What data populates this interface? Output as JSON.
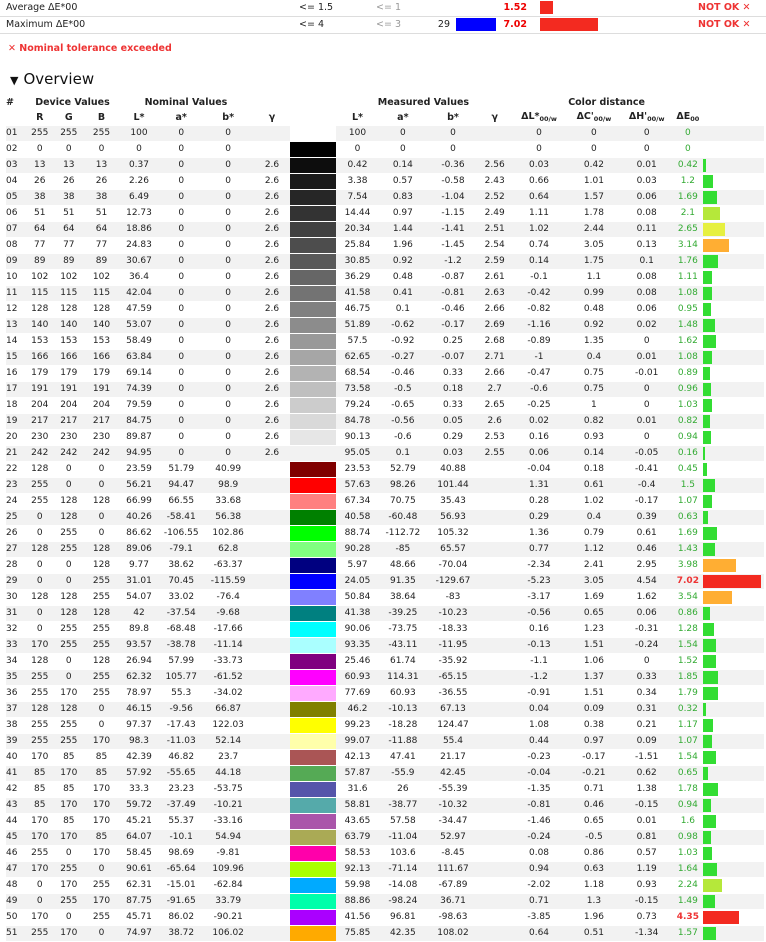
{
  "summary": {
    "rows": [
      {
        "label": "Average ΔE*00",
        "target": "<= 1.5",
        "nominal": "<= 1",
        "count": "",
        "value": "1.52",
        "value_num": 1.52,
        "bar_color": "#f32a20",
        "result": "NOT OK ✕"
      },
      {
        "label": "Maximum ΔE*00",
        "target": "<= 4",
        "nominal": "<= 3",
        "count": "29",
        "value": "7.02",
        "value_num": 7.02,
        "swatch": "#0000ff",
        "bar_color": "#f32a20",
        "result": "NOT OK ✕"
      }
    ],
    "warning": "✕ Nominal tolerance exceeded"
  },
  "overview": {
    "title": "Overview",
    "toggle": "▼",
    "group_headers": {
      "num": "#",
      "device": "Device Values",
      "nominal": "Nominal Values",
      "measured": "Measured Values",
      "distance": "Color distance"
    },
    "col_headers": [
      "R",
      "G",
      "B",
      "L*",
      "a*",
      "b*",
      "γ",
      "L*",
      "a*",
      "b*",
      "γ",
      "ΔL*",
      "ΔC'",
      "ΔH'",
      "ΔE"
    ],
    "rows": [
      [
        "01",
        "255",
        "255",
        "255",
        "100",
        "0",
        "0",
        "",
        "#ffffff",
        "100",
        "0",
        "0",
        "",
        "0",
        "0",
        "0",
        "0"
      ],
      [
        "02",
        "0",
        "0",
        "0",
        "0",
        "0",
        "0",
        "",
        "#000000",
        "0",
        "0",
        "0",
        "",
        "0",
        "0",
        "0",
        "0"
      ],
      [
        "03",
        "13",
        "13",
        "13",
        "0.37",
        "0",
        "0",
        "2.6",
        "#0d0d0d",
        "0.42",
        "0.14",
        "-0.36",
        "2.56",
        "0.03",
        "0.42",
        "0.01",
        "0.42"
      ],
      [
        "04",
        "26",
        "26",
        "26",
        "2.26",
        "0",
        "0",
        "2.6",
        "#1a1a1a",
        "3.38",
        "0.57",
        "-0.58",
        "2.43",
        "0.66",
        "1.01",
        "0.03",
        "1.2"
      ],
      [
        "05",
        "38",
        "38",
        "38",
        "6.49",
        "0",
        "0",
        "2.6",
        "#262626",
        "7.54",
        "0.83",
        "-1.04",
        "2.52",
        "0.64",
        "1.57",
        "0.06",
        "1.69"
      ],
      [
        "06",
        "51",
        "51",
        "51",
        "12.73",
        "0",
        "0",
        "2.6",
        "#333333",
        "14.44",
        "0.97",
        "-1.15",
        "2.49",
        "1.11",
        "1.78",
        "0.08",
        "2.1"
      ],
      [
        "07",
        "64",
        "64",
        "64",
        "18.86",
        "0",
        "0",
        "2.6",
        "#404040",
        "20.34",
        "1.44",
        "-1.41",
        "2.51",
        "1.02",
        "2.44",
        "0.11",
        "2.65"
      ],
      [
        "08",
        "77",
        "77",
        "77",
        "24.83",
        "0",
        "0",
        "2.6",
        "#4d4d4d",
        "25.84",
        "1.96",
        "-1.45",
        "2.54",
        "0.74",
        "3.05",
        "0.13",
        "3.14"
      ],
      [
        "09",
        "89",
        "89",
        "89",
        "30.67",
        "0",
        "0",
        "2.6",
        "#595959",
        "30.85",
        "0.92",
        "-1.2",
        "2.59",
        "0.14",
        "1.75",
        "0.1",
        "1.76"
      ],
      [
        "10",
        "102",
        "102",
        "102",
        "36.4",
        "0",
        "0",
        "2.6",
        "#666666",
        "36.29",
        "0.48",
        "-0.87",
        "2.61",
        "-0.1",
        "1.1",
        "0.08",
        "1.11"
      ],
      [
        "11",
        "115",
        "115",
        "115",
        "42.04",
        "0",
        "0",
        "2.6",
        "#737373",
        "41.58",
        "0.41",
        "-0.81",
        "2.63",
        "-0.42",
        "0.99",
        "0.08",
        "1.08"
      ],
      [
        "12",
        "128",
        "128",
        "128",
        "47.59",
        "0",
        "0",
        "2.6",
        "#808080",
        "46.75",
        "0.1",
        "-0.46",
        "2.66",
        "-0.82",
        "0.48",
        "0.06",
        "0.95"
      ],
      [
        "13",
        "140",
        "140",
        "140",
        "53.07",
        "0",
        "0",
        "2.6",
        "#8c8c8c",
        "51.89",
        "-0.62",
        "-0.17",
        "2.69",
        "-1.16",
        "0.92",
        "0.02",
        "1.48"
      ],
      [
        "14",
        "153",
        "153",
        "153",
        "58.49",
        "0",
        "0",
        "2.6",
        "#999999",
        "57.5",
        "-0.92",
        "0.25",
        "2.68",
        "-0.89",
        "1.35",
        "0",
        "1.62"
      ],
      [
        "15",
        "166",
        "166",
        "166",
        "63.84",
        "0",
        "0",
        "2.6",
        "#a6a6a6",
        "62.65",
        "-0.27",
        "-0.07",
        "2.71",
        "-1",
        "0.4",
        "0.01",
        "1.08"
      ],
      [
        "16",
        "179",
        "179",
        "179",
        "69.14",
        "0",
        "0",
        "2.6",
        "#b3b3b3",
        "68.54",
        "-0.46",
        "0.33",
        "2.66",
        "-0.47",
        "0.75",
        "-0.01",
        "0.89"
      ],
      [
        "17",
        "191",
        "191",
        "191",
        "74.39",
        "0",
        "0",
        "2.6",
        "#bfbfbf",
        "73.58",
        "-0.5",
        "0.18",
        "2.7",
        "-0.6",
        "0.75",
        "0",
        "0.96"
      ],
      [
        "18",
        "204",
        "204",
        "204",
        "79.59",
        "0",
        "0",
        "2.6",
        "#cccccc",
        "79.24",
        "-0.65",
        "0.33",
        "2.65",
        "-0.25",
        "1",
        "0",
        "1.03"
      ],
      [
        "19",
        "217",
        "217",
        "217",
        "84.75",
        "0",
        "0",
        "2.6",
        "#d9d9d9",
        "84.78",
        "-0.56",
        "0.05",
        "2.6",
        "0.02",
        "0.82",
        "0.01",
        "0.82"
      ],
      [
        "20",
        "230",
        "230",
        "230",
        "89.87",
        "0",
        "0",
        "2.6",
        "#e6e6e6",
        "90.13",
        "-0.6",
        "0.29",
        "2.53",
        "0.16",
        "0.93",
        "0",
        "0.94"
      ],
      [
        "21",
        "242",
        "242",
        "242",
        "94.95",
        "0",
        "0",
        "2.6",
        "#f2f2f2",
        "95.05",
        "0.1",
        "0.03",
        "2.55",
        "0.06",
        "0.14",
        "-0.05",
        "0.16"
      ],
      [
        "22",
        "128",
        "0",
        "0",
        "23.59",
        "51.79",
        "40.99",
        "",
        "#800000",
        "23.53",
        "52.79",
        "40.88",
        "",
        "-0.04",
        "0.18",
        "-0.41",
        "0.45"
      ],
      [
        "23",
        "255",
        "0",
        "0",
        "56.21",
        "94.47",
        "98.9",
        "",
        "#ff0000",
        "57.63",
        "98.26",
        "101.44",
        "",
        "1.31",
        "0.61",
        "-0.4",
        "1.5"
      ],
      [
        "24",
        "255",
        "128",
        "128",
        "66.99",
        "66.55",
        "33.68",
        "",
        "#ff8080",
        "67.34",
        "70.75",
        "35.43",
        "",
        "0.28",
        "1.02",
        "-0.17",
        "1.07"
      ],
      [
        "25",
        "0",
        "128",
        "0",
        "40.26",
        "-58.41",
        "56.38",
        "",
        "#008000",
        "40.58",
        "-60.48",
        "56.93",
        "",
        "0.29",
        "0.4",
        "0.39",
        "0.63"
      ],
      [
        "26",
        "0",
        "255",
        "0",
        "86.62",
        "-106.55",
        "102.86",
        "",
        "#00ff00",
        "88.74",
        "-112.72",
        "105.32",
        "",
        "1.36",
        "0.79",
        "0.61",
        "1.69"
      ],
      [
        "27",
        "128",
        "255",
        "128",
        "89.06",
        "-79.1",
        "62.8",
        "",
        "#80ff80",
        "90.28",
        "-85",
        "65.57",
        "",
        "0.77",
        "1.12",
        "0.46",
        "1.43"
      ],
      [
        "28",
        "0",
        "0",
        "128",
        "9.77",
        "38.62",
        "-63.37",
        "",
        "#000080",
        "5.97",
        "48.66",
        "-70.04",
        "",
        "-2.34",
        "2.41",
        "2.95",
        "3.98"
      ],
      [
        "29",
        "0",
        "0",
        "255",
        "31.01",
        "70.45",
        "-115.59",
        "",
        "#0000ff",
        "24.05",
        "91.35",
        "-129.67",
        "",
        "-5.23",
        "3.05",
        "4.54",
        "7.02"
      ],
      [
        "30",
        "128",
        "128",
        "255",
        "54.07",
        "33.02",
        "-76.4",
        "",
        "#8080ff",
        "50.84",
        "38.64",
        "-83",
        "",
        "-3.17",
        "1.69",
        "1.62",
        "3.54"
      ],
      [
        "31",
        "0",
        "128",
        "128",
        "42",
        "-37.54",
        "-9.68",
        "",
        "#008080",
        "41.38",
        "-39.25",
        "-10.23",
        "",
        "-0.56",
        "0.65",
        "0.06",
        "0.86"
      ],
      [
        "32",
        "0",
        "255",
        "255",
        "89.8",
        "-68.48",
        "-17.66",
        "",
        "#00ffff",
        "90.06",
        "-73.75",
        "-18.33",
        "",
        "0.16",
        "1.23",
        "-0.31",
        "1.28"
      ],
      [
        "33",
        "170",
        "255",
        "255",
        "93.57",
        "-38.78",
        "-11.14",
        "",
        "#aaffff",
        "93.35",
        "-43.11",
        "-11.95",
        "",
        "-0.13",
        "1.51",
        "-0.24",
        "1.54"
      ],
      [
        "34",
        "128",
        "0",
        "128",
        "26.94",
        "57.99",
        "-33.73",
        "",
        "#800080",
        "25.46",
        "61.74",
        "-35.92",
        "",
        "-1.1",
        "1.06",
        "0",
        "1.52"
      ],
      [
        "35",
        "255",
        "0",
        "255",
        "62.32",
        "105.77",
        "-61.52",
        "",
        "#ff00ff",
        "60.93",
        "114.31",
        "-65.15",
        "",
        "-1.2",
        "1.37",
        "0.33",
        "1.85"
      ],
      [
        "36",
        "255",
        "170",
        "255",
        "78.97",
        "55.3",
        "-34.02",
        "",
        "#ffaaff",
        "77.69",
        "60.93",
        "-36.55",
        "",
        "-0.91",
        "1.51",
        "0.34",
        "1.79"
      ],
      [
        "37",
        "128",
        "128",
        "0",
        "46.15",
        "-9.56",
        "66.87",
        "",
        "#808000",
        "46.2",
        "-10.13",
        "67.13",
        "",
        "0.04",
        "0.09",
        "0.31",
        "0.32"
      ],
      [
        "38",
        "255",
        "255",
        "0",
        "97.37",
        "-17.43",
        "122.03",
        "",
        "#ffff00",
        "99.23",
        "-18.28",
        "124.47",
        "",
        "1.08",
        "0.38",
        "0.21",
        "1.17"
      ],
      [
        "39",
        "255",
        "255",
        "170",
        "98.3",
        "-11.03",
        "52.14",
        "",
        "#ffffaa",
        "99.07",
        "-11.88",
        "55.4",
        "",
        "0.44",
        "0.97",
        "0.09",
        "1.07"
      ],
      [
        "40",
        "170",
        "85",
        "85",
        "42.39",
        "46.82",
        "23.7",
        "",
        "#aa5555",
        "42.13",
        "47.41",
        "21.17",
        "",
        "-0.23",
        "-0.17",
        "-1.51",
        "1.54"
      ],
      [
        "41",
        "85",
        "170",
        "85",
        "57.92",
        "-55.65",
        "44.18",
        "",
        "#55aa55",
        "57.87",
        "-55.9",
        "42.45",
        "",
        "-0.04",
        "-0.21",
        "0.62",
        "0.65"
      ],
      [
        "42",
        "85",
        "85",
        "170",
        "33.3",
        "23.23",
        "-53.75",
        "",
        "#5555aa",
        "31.6",
        "26",
        "-55.39",
        "",
        "-1.35",
        "0.71",
        "1.38",
        "1.78"
      ],
      [
        "43",
        "85",
        "170",
        "170",
        "59.72",
        "-37.49",
        "-10.21",
        "",
        "#55aaaa",
        "58.81",
        "-38.77",
        "-10.32",
        "",
        "-0.81",
        "0.46",
        "-0.15",
        "0.94"
      ],
      [
        "44",
        "170",
        "85",
        "170",
        "45.21",
        "55.37",
        "-33.16",
        "",
        "#aa55aa",
        "43.65",
        "57.58",
        "-34.47",
        "",
        "-1.46",
        "0.65",
        "0.01",
        "1.6"
      ],
      [
        "45",
        "170",
        "170",
        "85",
        "64.07",
        "-10.1",
        "54.94",
        "",
        "#aaaa55",
        "63.79",
        "-11.04",
        "52.97",
        "",
        "-0.24",
        "-0.5",
        "0.81",
        "0.98"
      ],
      [
        "46",
        "255",
        "0",
        "170",
        "58.45",
        "98.69",
        "-9.81",
        "",
        "#ff00aa",
        "58.53",
        "103.6",
        "-8.45",
        "",
        "0.08",
        "0.86",
        "0.57",
        "1.03"
      ],
      [
        "47",
        "170",
        "255",
        "0",
        "90.61",
        "-65.64",
        "109.96",
        "",
        "#aaff00",
        "92.13",
        "-71.14",
        "111.67",
        "",
        "0.94",
        "0.63",
        "1.19",
        "1.64"
      ],
      [
        "48",
        "0",
        "170",
        "255",
        "62.31",
        "-15.01",
        "-62.84",
        "",
        "#00aaff",
        "59.98",
        "-14.08",
        "-67.89",
        "",
        "-2.02",
        "1.18",
        "0.93",
        "2.24"
      ],
      [
        "49",
        "0",
        "255",
        "170",
        "87.75",
        "-91.65",
        "33.79",
        "",
        "#00ffaa",
        "88.86",
        "-98.24",
        "36.71",
        "",
        "0.71",
        "1.3",
        "-0.15",
        "1.49"
      ],
      [
        "50",
        "170",
        "0",
        "255",
        "45.71",
        "86.02",
        "-90.21",
        "",
        "#aa00ff",
        "41.56",
        "96.81",
        "-98.63",
        "",
        "-3.85",
        "1.96",
        "0.73",
        "4.35"
      ],
      [
        "51",
        "255",
        "170",
        "0",
        "74.97",
        "38.72",
        "106.02",
        "",
        "#ffaa00",
        "75.85",
        "42.35",
        "108.02",
        "",
        "0.64",
        "0.51",
        "-1.34",
        "1.57"
      ]
    ]
  }
}
